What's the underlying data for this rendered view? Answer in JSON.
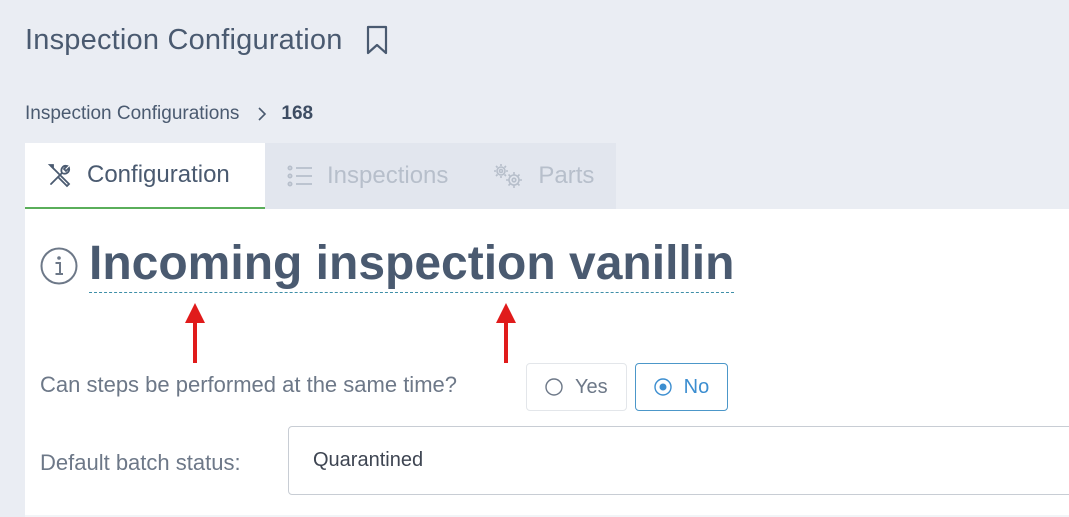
{
  "header": {
    "title": "Inspection Configuration",
    "bookmark_icon": "bookmark-icon"
  },
  "breadcrumb": {
    "parent": "Inspection Configurations",
    "current": "168"
  },
  "tabs": [
    {
      "label": "Configuration",
      "icon": "tools-icon",
      "active": true
    },
    {
      "label": "Inspections",
      "icon": "list-icon",
      "active": false
    },
    {
      "label": "Parts",
      "icon": "gears-icon",
      "active": false
    }
  ],
  "config": {
    "name": "Incoming inspection vanillin",
    "parallel_label": "Can steps be performed at the same time?",
    "parallel_options": [
      "Yes",
      "No"
    ],
    "parallel_selected": "No",
    "batch_label": "Default batch status:",
    "batch_value": "Quarantined"
  },
  "colors": {
    "accent": "#3c8ed0",
    "active_tab_border": "#5aae5a",
    "annotation_arrow": "#e01b1b"
  }
}
